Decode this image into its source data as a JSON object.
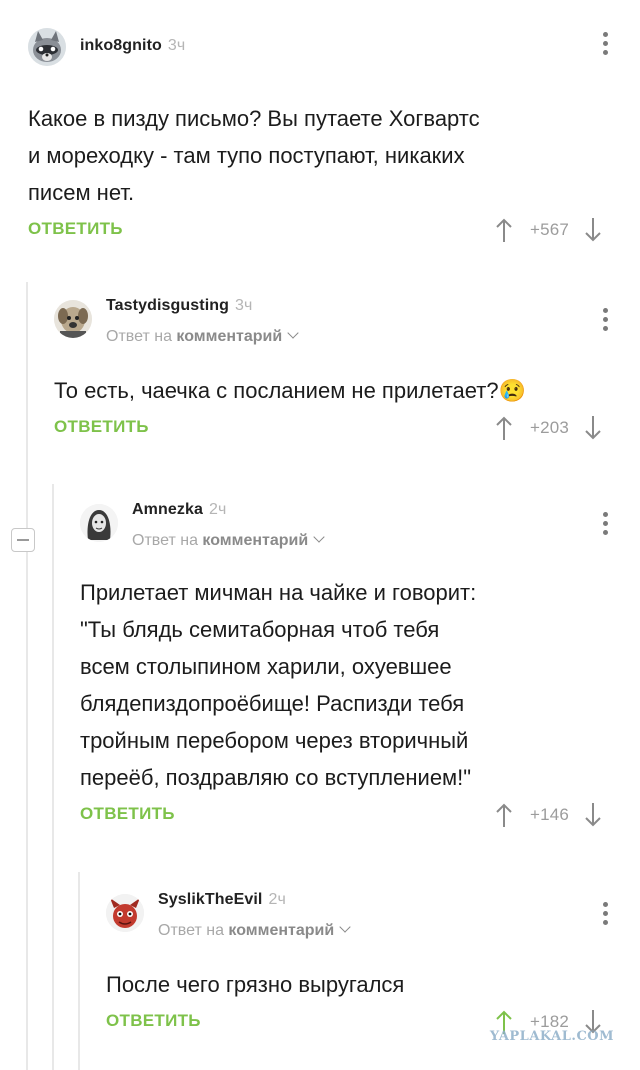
{
  "comments": [
    {
      "username": "inko8gnito",
      "time": "3ч",
      "body_lines": [
        "Какое в пизду письмо? Вы путаете Хогвартс",
        "и мореходку - там тупо поступают, никаких",
        "писем нет."
      ],
      "reply_label": "ОТВЕТИТЬ",
      "score": "+567",
      "avatar_icon": "raccoon-avatar"
    },
    {
      "username": "Tastydisgusting",
      "time": "3ч",
      "reply_to_prefix": "Ответ на",
      "reply_to_link": "комментарий",
      "body_lines": [
        "То есть, чаечка с посланием не прилетает?"
      ],
      "emoji": "😢",
      "reply_label": "ОТВЕТИТЬ",
      "score": "+203",
      "avatar_icon": "dog-avatar"
    },
    {
      "username": "Amnezka",
      "time": "2ч",
      "reply_to_prefix": "Ответ на",
      "reply_to_link": "комментарий",
      "body_lines": [
        "Прилетает мичман на чайке и говорит:",
        "\"Ты блядь семитаборная чтоб тебя",
        "всем столыпином харили, охуевшее",
        "блядепиздопроёбище! Распизди тебя",
        "тройным перебором через вторичный",
        "переёб, поздравляю со вступлением!\""
      ],
      "reply_label": "ОТВЕТИТЬ",
      "score": "+146",
      "avatar_icon": "sketch-portrait-avatar"
    },
    {
      "username": "SyslikTheEvil",
      "time": "2ч",
      "reply_to_prefix": "Ответ на",
      "reply_to_link": "комментарий",
      "body_lines": [
        "После чего грязно выругался"
      ],
      "reply_label": "ОТВЕТИТЬ",
      "score": "+182",
      "avatar_icon": "red-creature-avatar"
    }
  ],
  "watermark": "YAPLAKAL.COM",
  "colors": {
    "accent_green": "#7ec24a",
    "muted_gray": "#a8a8a8"
  }
}
